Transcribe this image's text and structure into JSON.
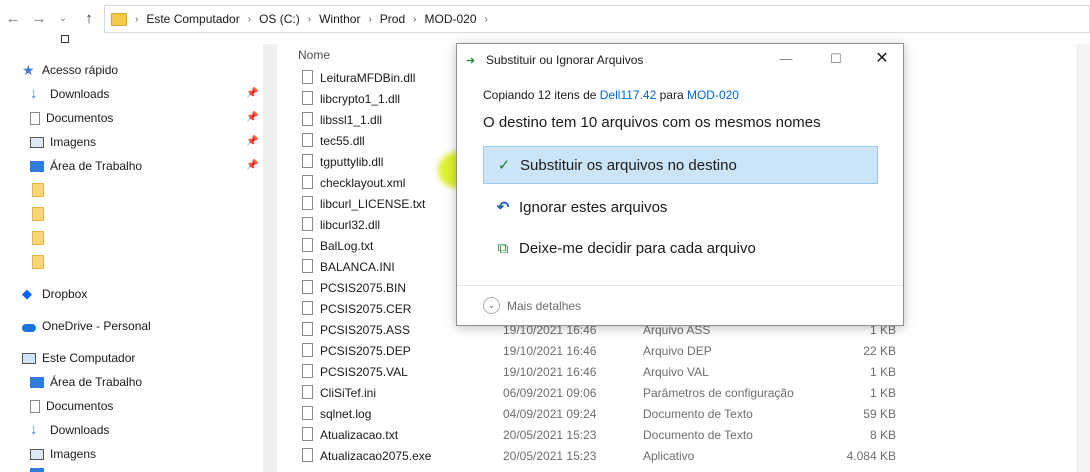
{
  "address_bar": {
    "crumbs": [
      "Este Computador",
      "OS (C:)",
      "Winthor",
      "Prod",
      "MOD-020"
    ]
  },
  "sidebar": {
    "quick_access": "Acesso rápido",
    "pinned": [
      "Downloads",
      "Documentos",
      "Imagens",
      "Área de Trabalho"
    ],
    "dropbox": "Dropbox",
    "onedrive": "OneDrive - Personal",
    "this_pc": "Este Computador",
    "pc_items": [
      "Área de Trabalho",
      "Documentos",
      "Downloads",
      "Imagens"
    ]
  },
  "file_list": {
    "column_name": "Nome",
    "files": [
      {
        "name": "LeituraMFDBin.dll",
        "date": "",
        "type": "",
        "size": ""
      },
      {
        "name": "libcrypto1_1.dll",
        "date": "",
        "type": "",
        "size": ""
      },
      {
        "name": "libssl1_1.dll",
        "date": "",
        "type": "",
        "size": ""
      },
      {
        "name": "tec55.dll",
        "date": "",
        "type": "",
        "size": ""
      },
      {
        "name": "tgputtylib.dll",
        "date": "",
        "type": "",
        "size": ""
      },
      {
        "name": "checklayout.xml",
        "date": "",
        "type": "",
        "size": ""
      },
      {
        "name": "libcurl_LICENSE.txt",
        "date": "",
        "type": "",
        "size": ""
      },
      {
        "name": "libcurl32.dll",
        "date": "",
        "type": "",
        "size": ""
      },
      {
        "name": "BalLog.txt",
        "date": "",
        "type": "",
        "size": ""
      },
      {
        "name": "BALANCA.INI",
        "date": "",
        "type": "",
        "size": ""
      },
      {
        "name": "PCSIS2075.BIN",
        "date": "",
        "type": "",
        "size": ""
      },
      {
        "name": "PCSIS2075.CER",
        "date": "",
        "type": "",
        "size": ""
      },
      {
        "name": "PCSIS2075.ASS",
        "date": "19/10/2021 16:46",
        "type": "Arquivo ASS",
        "size": "1 KB"
      },
      {
        "name": "PCSIS2075.DEP",
        "date": "19/10/2021 16:46",
        "type": "Arquivo DEP",
        "size": "22 KB"
      },
      {
        "name": "PCSIS2075.VAL",
        "date": "19/10/2021 16:46",
        "type": "Arquivo VAL",
        "size": "1 KB"
      },
      {
        "name": "CliSiTef.ini",
        "date": "06/09/2021 09:06",
        "type": "Parâmetros de configuração",
        "size": "1 KB"
      },
      {
        "name": "sqlnet.log",
        "date": "04/09/2021 09:24",
        "type": "Documento de Texto",
        "size": "59 KB"
      },
      {
        "name": "Atualizacao.txt",
        "date": "20/05/2021 15:23",
        "type": "Documento de Texto",
        "size": "8 KB"
      },
      {
        "name": "Atualizacao2075.exe",
        "date": "20/05/2021 15:23",
        "type": "Aplicativo",
        "size": "4.084 KB"
      }
    ]
  },
  "dialog": {
    "title": "Substituir ou Ignorar Arquivos",
    "copying_prefix": "Copiando 12 itens de",
    "source": "Dell117.42",
    "para": "para",
    "destination": "MOD-020",
    "message": "O destino tem 10 arquivos com os mesmos nomes",
    "options": [
      "Substituir os arquivos no destino",
      "Ignorar estes arquivos",
      "Deixe-me decidir para cada arquivo"
    ],
    "more_details": "Mais detalhes",
    "link_color": "#0066cc",
    "selected_bg": "#cce4f7",
    "highlight_color": "#d7ee00"
  }
}
